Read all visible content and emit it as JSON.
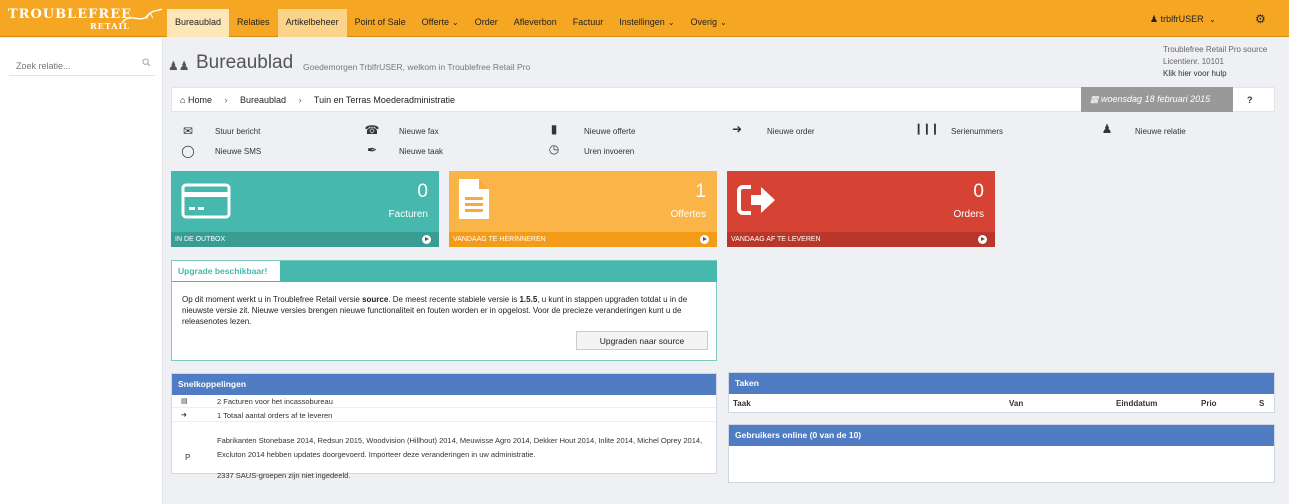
{
  "app": {
    "logo_line1": "TROUBLEFREE",
    "logo_line2": "RETAIL"
  },
  "nav": {
    "items": [
      {
        "label": "Bureaublad"
      },
      {
        "label": "Relaties"
      },
      {
        "label": "Artikelbeheer"
      },
      {
        "label": "Point of Sale"
      },
      {
        "label": "Offerte"
      },
      {
        "label": "Order"
      },
      {
        "label": "Afleverbon"
      },
      {
        "label": "Factuur"
      },
      {
        "label": "Instellingen"
      },
      {
        "label": "Overig"
      }
    ],
    "user": "trblfrUSER"
  },
  "sidebar": {
    "search_placeholder": "Zoek relatie..."
  },
  "header": {
    "title": "Bureaublad",
    "greeting": "Goedemorgen TrblfrUSER, welkom in Troublefree Retail Pro",
    "product": "Troublefree Retail Pro source",
    "license": "Licentienr. 10101",
    "help": "Klik hier voor hulp"
  },
  "breadcrumb": {
    "home": "Home",
    "level1": "Bureaublad",
    "level2": "Tuin en Terras Moederadministratie",
    "date": "woensdag 18 februari 2015",
    "help": "?"
  },
  "quick_actions": {
    "stuur_bericht": "Stuur bericht",
    "nieuwe_sms": "Nieuwe SMS",
    "nieuwe_fax": "Nieuwe fax",
    "nieuwe_taak": "Nieuwe taak",
    "nieuwe_offerte": "Nieuwe offerte",
    "uren_invoeren": "Uren invoeren",
    "nieuwe_order": "Nieuwe order",
    "serienummers": "Serienummers",
    "nieuwe_relatie": "Nieuwe relatie"
  },
  "tiles": {
    "facturen": {
      "count": "0",
      "label": "Facturen",
      "footer": "IN DE OUTBOX",
      "color": "#46b8ae"
    },
    "offertes": {
      "count": "1",
      "label": "Offertes",
      "footer": "VANDAAG TE HERINNEREN",
      "color": "#fbb448"
    },
    "orders": {
      "count": "0",
      "label": "Orders",
      "footer": "VANDAAG AF TE LEVEREN",
      "color": "#d64334"
    }
  },
  "upgrade": {
    "title": "Upgrade beschikbaar!",
    "text_a": "Op dit moment werkt u in Troublefree Retail versie ",
    "version_current": "source",
    "text_b": ". De meest recente stabiele versie is ",
    "version_latest": "1.5.5",
    "text_c": ", u kunt in stappen upgraden totdat u in de nieuwste versie zit. Nieuwe versies brengen nieuwe functionaliteit en fouten worden er in opgelost. Voor de precieze veranderingen kunt u de releasenotes lezen.",
    "button": "Upgraden naar source"
  },
  "snelkoppelingen": {
    "title": "Snelkoppelingen",
    "rows": [
      "2 Facturen voor het incassobureau",
      "1 Totaal aantal orders af te leveren"
    ],
    "updates": "Fabrikanten Stonebase 2014, Redsun 2015, Woodvision (Hillhout) 2014, Meuwisse Agro 2014, Dekker Hout 2014, Inlite 2014, Michel Oprey 2014, Excluton 2014 hebben updates doorgevoerd. Importeer deze veranderingen in uw administratie.",
    "saus": "2337 SAUS-groepen zijn niet ingedeeld.",
    "p_label": "P"
  },
  "taken": {
    "title": "Taken",
    "columns": [
      "Taak",
      "Van",
      "Einddatum",
      "Prio",
      "S"
    ]
  },
  "online": {
    "title": "Gebruikers online (0 van de 10)"
  }
}
